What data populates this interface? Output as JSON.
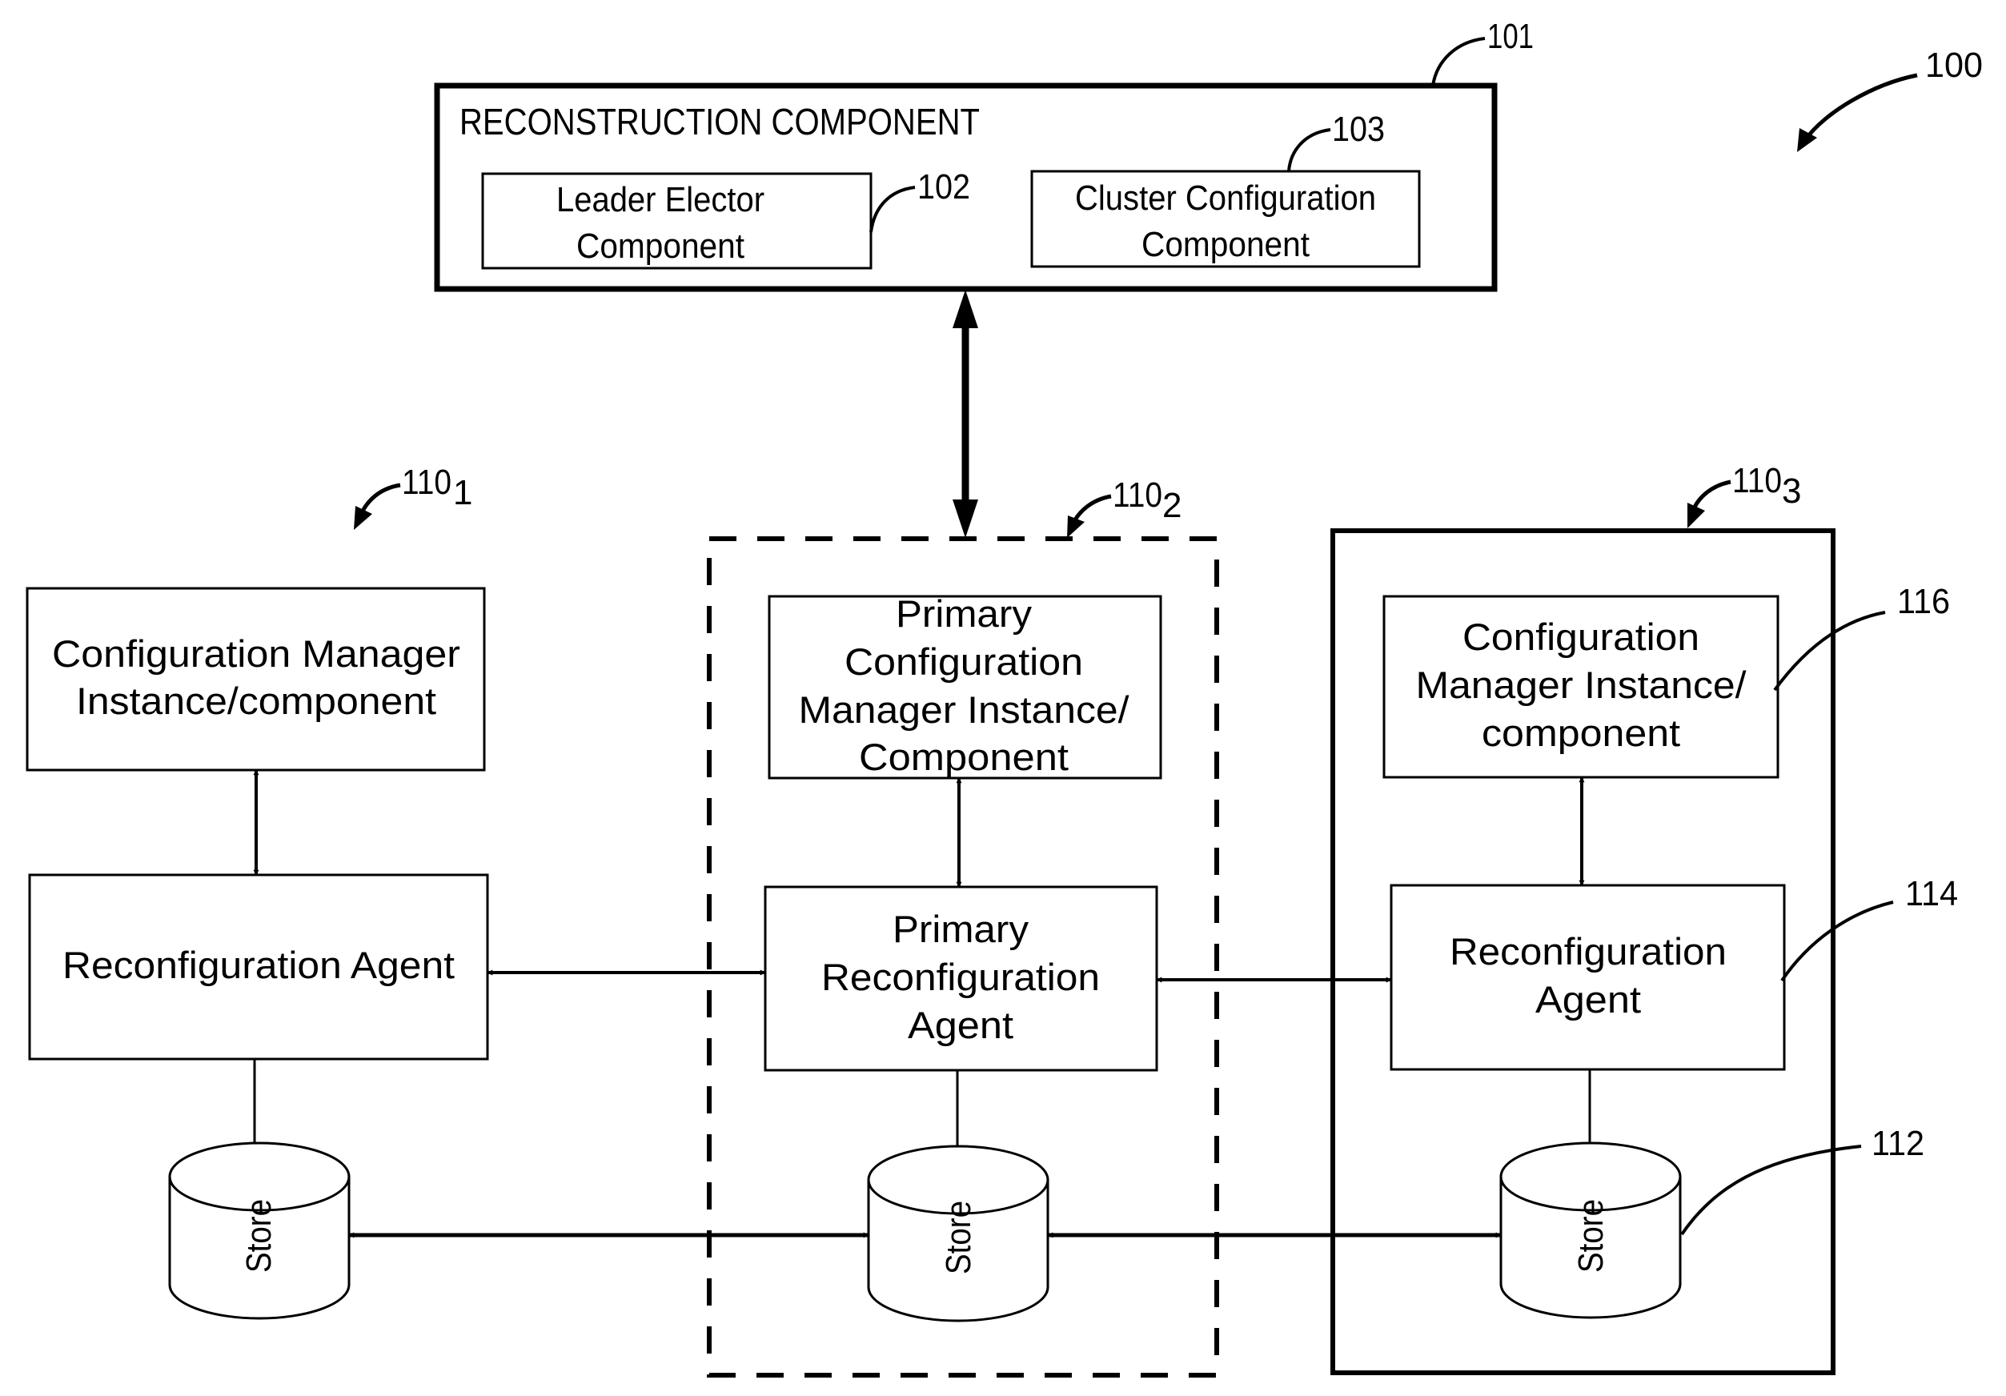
{
  "figure": {
    "ref": "100",
    "reconstruction": {
      "ref": "101",
      "title": "RECONSTRUCTION COMPONENT",
      "leader_elector": {
        "ref": "102",
        "lines": [
          "Leader Elector",
          "Component"
        ]
      },
      "cluster_config": {
        "ref": "103",
        "lines": [
          "Cluster Configuration",
          "Component"
        ]
      }
    },
    "nodes": [
      {
        "ref_base": "110",
        "ref_sub": "1",
        "config_manager": {
          "lines": [
            "Configuration Manager",
            "Instance/component"
          ]
        },
        "agent": {
          "lines": [
            "Reconfiguration Agent"
          ]
        },
        "store": {
          "label": "Store"
        }
      },
      {
        "ref_base": "110",
        "ref_sub": "2",
        "config_manager": {
          "lines": [
            "Primary",
            "Configuration",
            "Manager Instance/",
            "Component"
          ]
        },
        "agent": {
          "lines": [
            "Primary",
            "Reconfiguration",
            "Agent"
          ]
        },
        "store": {
          "label": "Store"
        }
      },
      {
        "ref_base": "110",
        "ref_sub": "3",
        "config_manager": {
          "ref": "116",
          "lines": [
            "Configuration",
            "Manager Instance/",
            "component"
          ]
        },
        "agent": {
          "ref": "114",
          "lines": [
            "Reconfiguration",
            "Agent"
          ]
        },
        "store": {
          "ref": "112",
          "label": "Store"
        }
      }
    ]
  }
}
